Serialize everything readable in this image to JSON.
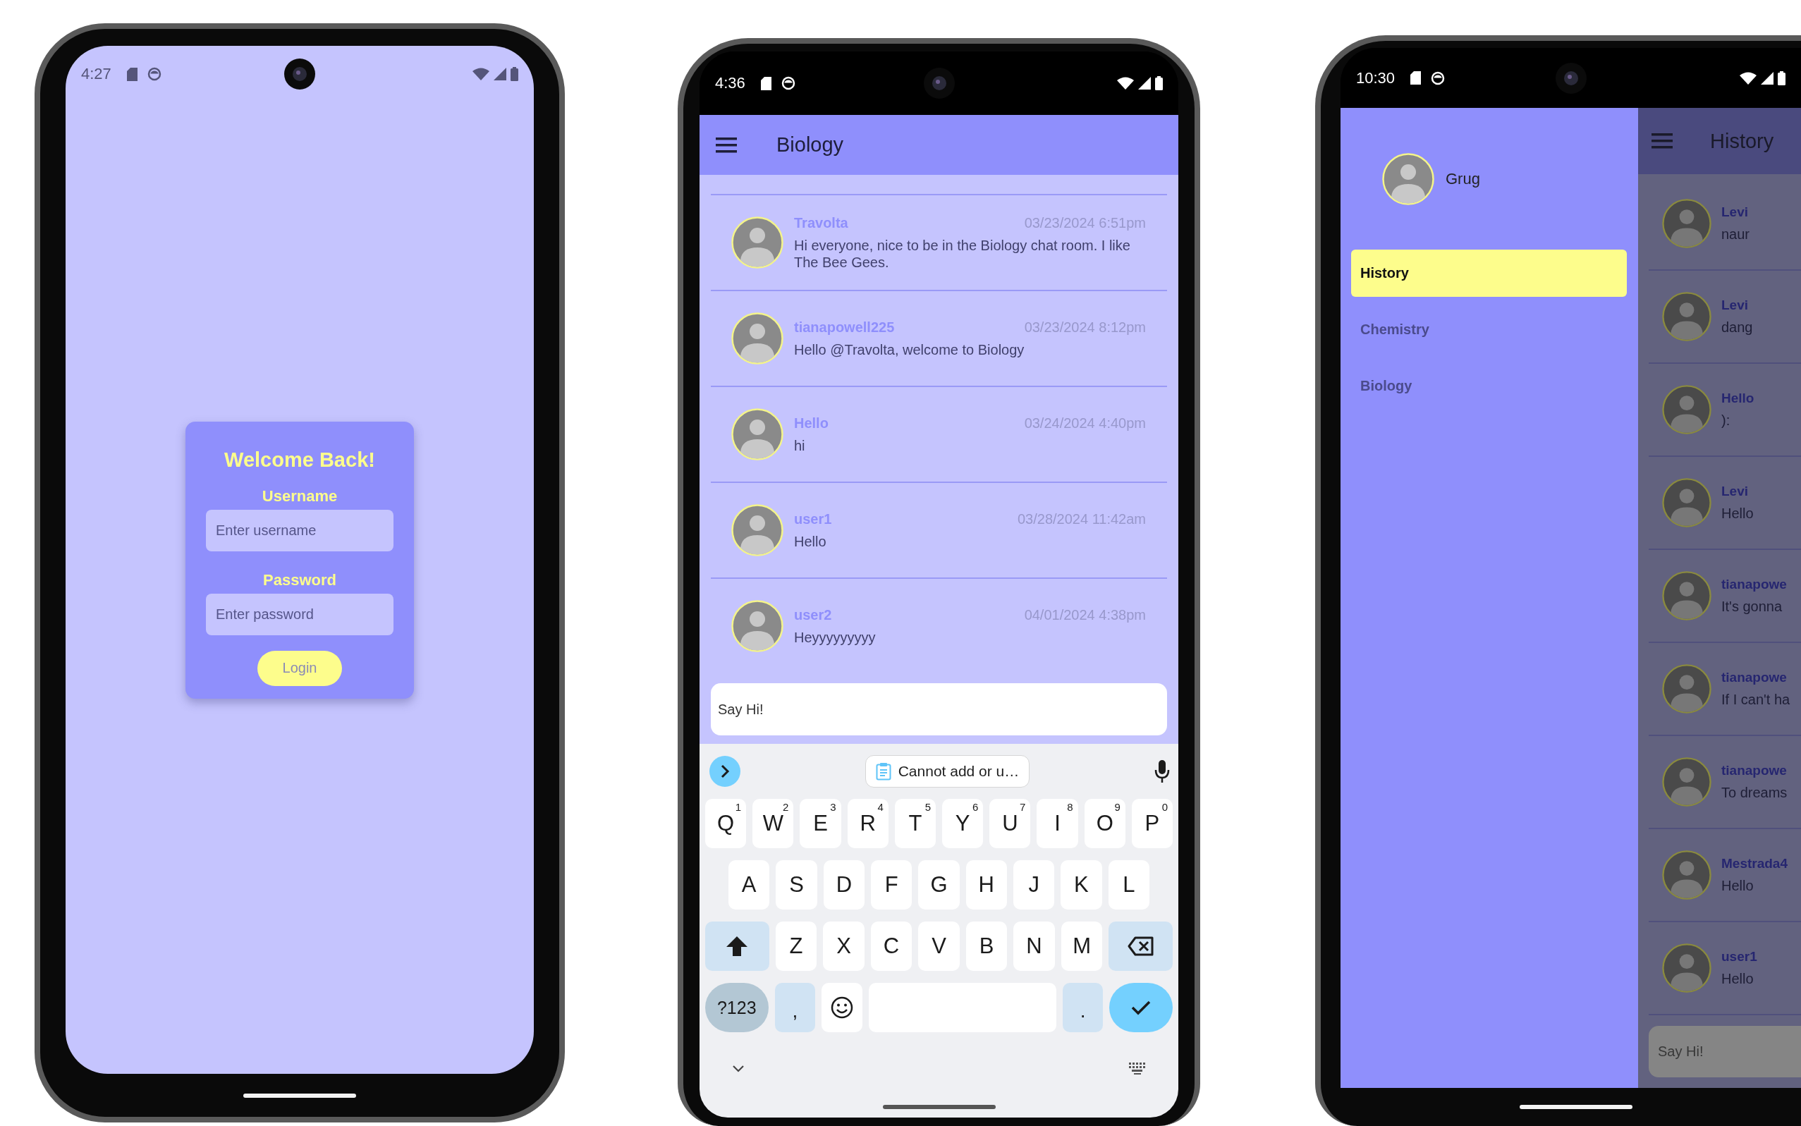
{
  "phones": [
    {
      "kind": "login",
      "status_bar": {
        "time": "4:27"
      },
      "login_card": {
        "title": "Welcome Back!",
        "fields": [
          {
            "label": "Username",
            "placeholder": "Enter username"
          },
          {
            "label": "Password",
            "placeholder": "Enter password"
          }
        ],
        "button": "Login"
      }
    },
    {
      "kind": "chat",
      "status_bar": {
        "time": "4:36"
      },
      "app_bar": {
        "title": "Biology"
      },
      "messages": [
        {
          "user": "Travolta",
          "time": "03/23/2024 6:51pm",
          "text": "Hi everyone, nice to be in the Biology chat room. I like The Bee Gees."
        },
        {
          "user": "tianapowell225",
          "time": "03/23/2024 8:12pm",
          "text": "Hello @Travolta, welcome to Biology"
        },
        {
          "user": "Hello",
          "time": "03/24/2024 4:40pm",
          "text": "hi"
        },
        {
          "user": "user1",
          "time": "03/28/2024 11:42am",
          "text": "Hello"
        },
        {
          "user": "user2",
          "time": "04/01/2024 4:38pm",
          "text": "Heyyyyyyyyy"
        }
      ],
      "composer": {
        "placeholder": "Say Hi!"
      },
      "keyboard": {
        "suggestion": "Cannot add or u…",
        "rows": [
          {
            "keys": [
              {
                "kind": "letter",
                "label": "Q",
                "hint": "1"
              },
              {
                "kind": "letter",
                "label": "W",
                "hint": "2"
              },
              {
                "kind": "letter",
                "label": "E",
                "hint": "3"
              },
              {
                "kind": "letter",
                "label": "R",
                "hint": "4"
              },
              {
                "kind": "letter",
                "label": "T",
                "hint": "5"
              },
              {
                "kind": "letter",
                "label": "Y",
                "hint": "6"
              },
              {
                "kind": "letter",
                "label": "U",
                "hint": "7"
              },
              {
                "kind": "letter",
                "label": "I",
                "hint": "8"
              },
              {
                "kind": "letter",
                "label": "O",
                "hint": "9"
              },
              {
                "kind": "letter",
                "label": "P",
                "hint": "0"
              }
            ]
          },
          {
            "keys": [
              {
                "kind": "letter",
                "label": "A"
              },
              {
                "kind": "letter",
                "label": "S"
              },
              {
                "kind": "letter",
                "label": "D"
              },
              {
                "kind": "letter",
                "label": "F"
              },
              {
                "kind": "letter",
                "label": "G"
              },
              {
                "kind": "letter",
                "label": "H"
              },
              {
                "kind": "letter",
                "label": "J"
              },
              {
                "kind": "letter",
                "label": "K"
              },
              {
                "kind": "letter",
                "label": "L"
              }
            ]
          },
          {
            "keys": [
              {
                "kind": "shift"
              },
              {
                "kind": "letter",
                "label": "Z"
              },
              {
                "kind": "letter",
                "label": "X"
              },
              {
                "kind": "letter",
                "label": "C"
              },
              {
                "kind": "letter",
                "label": "V"
              },
              {
                "kind": "letter",
                "label": "B"
              },
              {
                "kind": "letter",
                "label": "N"
              },
              {
                "kind": "letter",
                "label": "M"
              },
              {
                "kind": "backspace"
              }
            ]
          },
          {
            "keys": [
              {
                "kind": "symbols",
                "label": "?123"
              },
              {
                "kind": "punct",
                "label": ","
              },
              {
                "kind": "emoji"
              },
              {
                "kind": "space"
              },
              {
                "kind": "punct",
                "label": "."
              },
              {
                "kind": "enter"
              }
            ]
          }
        ]
      }
    },
    {
      "kind": "drawer",
      "status_bar": {
        "time": "10:30"
      },
      "drawer": {
        "user": "Grug",
        "items": [
          {
            "label": "History",
            "selected": true
          },
          {
            "label": "Chemistry",
            "selected": false
          },
          {
            "label": "Biology",
            "selected": false
          }
        ]
      },
      "app_bar": {
        "title": "History"
      },
      "messages": [
        {
          "user": "Levi",
          "text": "naur"
        },
        {
          "user": "Levi",
          "text": "dang"
        },
        {
          "user": "Hello",
          "text": "):"
        },
        {
          "user": "Levi",
          "text": "Hello"
        },
        {
          "user": "tianapowe",
          "text": "It's gonna"
        },
        {
          "user": "tianapowe",
          "text": "If I can't ha"
        },
        {
          "user": "tianapowe",
          "text": "To dreams"
        },
        {
          "user": "Mestrada4",
          "text": "Hello"
        },
        {
          "user": "user1",
          "text": "Hello"
        }
      ],
      "composer": {
        "placeholder": "Say Hi!"
      }
    }
  ]
}
